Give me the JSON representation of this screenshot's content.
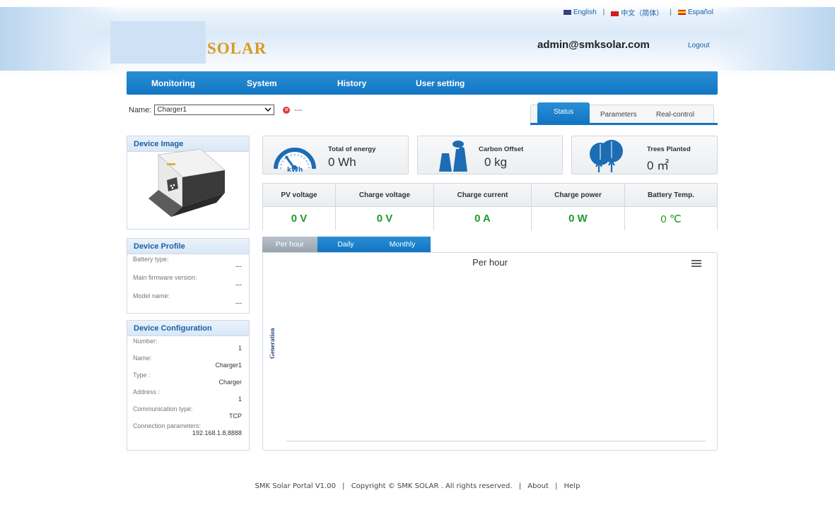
{
  "languages": [
    {
      "label": "English",
      "flag": "uk-flag"
    },
    {
      "label": "中文（简体）",
      "flag": "cn-flag"
    },
    {
      "label": "Español",
      "flag": "es-flag"
    }
  ],
  "header": {
    "logo_text": "SOLAR",
    "user_email": "admin@smksolar.com",
    "logout_label": "Logout"
  },
  "nav": {
    "items": [
      "Monitoring",
      "System",
      "History",
      "User setting"
    ]
  },
  "device_selector": {
    "label": "Name:",
    "selected": "Charger1",
    "dash": "---"
  },
  "view_tabs": {
    "active": "Status",
    "items": [
      "Status",
      "Parameters",
      "Real-control"
    ]
  },
  "device_image": {
    "title": "Device Image"
  },
  "device_profile": {
    "title": "Device Profile",
    "fields": [
      {
        "label": "Battery type:",
        "value": "---"
      },
      {
        "label": "Main firmware version:",
        "value": "---"
      },
      {
        "label": "Model name:",
        "value": "---"
      }
    ]
  },
  "device_config": {
    "title": "Device Configuration",
    "fields": [
      {
        "label": "Number:",
        "value": "1"
      },
      {
        "label": "Name:",
        "value": "Charger1"
      },
      {
        "label": "Type :",
        "value": "Charger"
      },
      {
        "label": "Address :",
        "value": "1"
      },
      {
        "label": "Communication type:",
        "value": "TCP"
      },
      {
        "label": "Connection parameters:",
        "value": "192.168.1.8,8888"
      }
    ]
  },
  "stats": {
    "energy": {
      "label": "Total of energy",
      "value": "0 Wh",
      "icon": "gauge-kwh-icon",
      "icon_text": "kWh"
    },
    "carbon": {
      "label": "Carbon Offset",
      "value": "0 kg",
      "icon": "cooling-tower-icon"
    },
    "trees": {
      "label": "Trees Planted",
      "value": "0 ㎡",
      "icon": "trees-icon"
    }
  },
  "measurements": {
    "headers": [
      "PV voltage",
      "Charge voltage",
      "Charge current",
      "Charge power",
      "Battery Temp."
    ],
    "values": [
      "0 V",
      "0 V",
      "0 A",
      "0 W",
      "0 ℃"
    ]
  },
  "chart_tabs": {
    "active": "Per hour",
    "items": [
      "Per hour",
      "Daily",
      "Monthly"
    ]
  },
  "chart_data": {
    "type": "bar",
    "title": "Per hour",
    "ylabel": "Generation",
    "categories": [],
    "values": []
  },
  "footer": {
    "text": "SMK Solar Portal V1.00",
    "copyright": "Copyright © SMK SOLAR . All rights reserved.",
    "about": "About",
    "help": "Help"
  },
  "colors": {
    "nav_blue": "#1275c2",
    "value_green": "#1e9b2c",
    "logo_gold": "#d99a1e",
    "link_blue": "#1a5fa8"
  }
}
